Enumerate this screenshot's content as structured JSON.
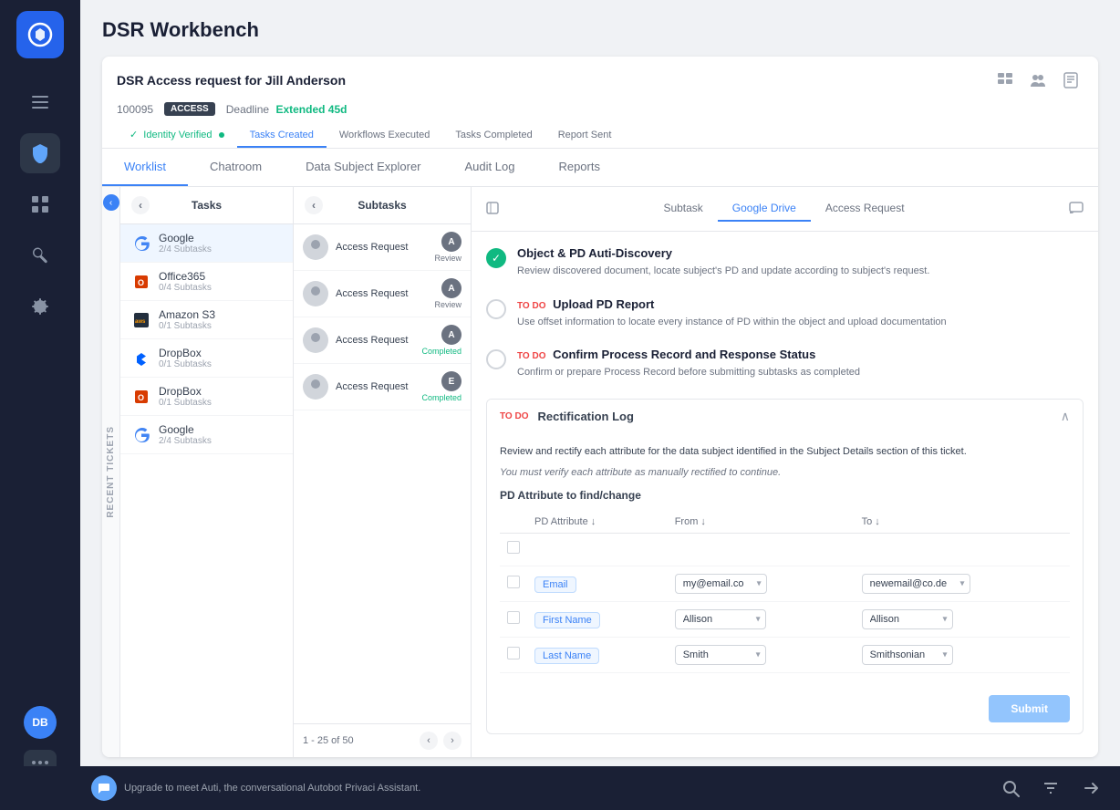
{
  "app": {
    "name": "securiti",
    "page_title": "DSR Workbench"
  },
  "sidebar": {
    "logo_text": "S",
    "menu_icon": "☰",
    "items": [
      {
        "id": "shield",
        "icon": "⬡",
        "active": true
      },
      {
        "id": "grid",
        "icon": "⊞",
        "active": false
      },
      {
        "id": "tools",
        "icon": "⚙",
        "active": false
      },
      {
        "id": "settings",
        "icon": "◎",
        "active": false
      }
    ],
    "avatar_initials": "DB",
    "dots_icon": "⠿"
  },
  "dsr": {
    "title": "DSR Access request for Jill Anderson",
    "ticket_id": "100095",
    "badge": "ACCESS",
    "deadline_label": "Deadline",
    "deadline_value": "Extended 45d"
  },
  "progress_tabs": [
    {
      "id": "identity",
      "label": "Identity Verified",
      "state": "done"
    },
    {
      "id": "tasks",
      "label": "Tasks Created",
      "state": "active"
    },
    {
      "id": "workflows",
      "label": "Workflows Executed",
      "state": "pending"
    },
    {
      "id": "completed",
      "label": "Tasks Completed",
      "state": "pending"
    },
    {
      "id": "report",
      "label": "Report Sent",
      "state": "pending"
    }
  ],
  "main_tabs": [
    {
      "id": "worklist",
      "label": "Worklist",
      "active": true
    },
    {
      "id": "chatroom",
      "label": "Chatroom",
      "active": false
    },
    {
      "id": "data_subject",
      "label": "Data Subject Explorer",
      "active": false
    },
    {
      "id": "audit",
      "label": "Audit Log",
      "active": false
    },
    {
      "id": "reports",
      "label": "Reports",
      "active": false
    }
  ],
  "recent_tickets": {
    "label": "RECENT TICKETS"
  },
  "tasks_panel": {
    "header": "Tasks",
    "items": [
      {
        "id": "google1",
        "logo_type": "google",
        "logo": "G",
        "name": "Google",
        "subtasks": "2/4 Subtasks",
        "active": true
      },
      {
        "id": "office365",
        "logo_type": "office",
        "logo": "O",
        "name": "Office365",
        "subtasks": "0/4 Subtasks"
      },
      {
        "id": "amazons3",
        "logo_type": "aws",
        "logo": "aws",
        "name": "Amazon S3",
        "subtasks": "0/1 Subtasks"
      },
      {
        "id": "dropbox1",
        "logo_type": "dropbox",
        "logo": "✦",
        "name": "DropBox",
        "subtasks": "0/1 Subtasks"
      },
      {
        "id": "dropbox2",
        "logo_type": "office",
        "logo": "O",
        "name": "DropBox",
        "subtasks": "0/1 Subtasks"
      },
      {
        "id": "google2",
        "logo_type": "google",
        "logo": "G",
        "name": "Google",
        "subtasks": "2/4 Subtasks"
      }
    ]
  },
  "subtasks_panel": {
    "header": "Subtasks",
    "items": [
      {
        "id": "sub1",
        "name": "Access Request",
        "badge": "A",
        "badge_class": "a-review",
        "status": "Review",
        "status_class": "review"
      },
      {
        "id": "sub2",
        "name": "Access Request",
        "badge": "A",
        "badge_class": "a-review",
        "status": "Review",
        "status_class": "review"
      },
      {
        "id": "sub3",
        "name": "Access Request",
        "badge": "A",
        "badge_class": "a-review",
        "status": "Completed",
        "status_class": "completed"
      },
      {
        "id": "sub4",
        "name": "Access Request",
        "badge": "E",
        "badge_class": "a-review",
        "status": "Completed",
        "status_class": "completed"
      }
    ],
    "pagination": "1 - 25 of 50"
  },
  "detail": {
    "tabs": [
      {
        "id": "subtask",
        "label": "Subtask",
        "active": false
      },
      {
        "id": "google_drive",
        "label": "Google Drive",
        "active": true
      },
      {
        "id": "access_request",
        "label": "Access Request",
        "active": false
      }
    ],
    "tasks": [
      {
        "id": "task1",
        "done": true,
        "title": "Object & PD Auti-Discovery",
        "description": "Review discovered document, locate subject's PD and update according to subject's request."
      },
      {
        "id": "task2",
        "done": false,
        "todo": true,
        "title": "Upload PD Report",
        "description": "Use offset information to locate every instance of PD within the object and upload documentation"
      },
      {
        "id": "task3",
        "done": false,
        "todo": true,
        "title": "Confirm Process Record and Response Status",
        "description": "Confirm or prepare Process Record before submitting subtasks as completed"
      }
    ],
    "rectification": {
      "todo_label": "TO DO",
      "section_title": "Rectification Log",
      "description": "Review and rectify each attribute for the data subject identified in the Subject Details section of this ticket.",
      "note": "You must verify each attribute as manually rectified to continue.",
      "pd_section_title": "PD Attribute to find/change",
      "table_headers": [
        "PD Attribute ↓",
        "From ↓",
        "To ↓"
      ],
      "rows": [
        {
          "id": "row_email",
          "attribute": "Email",
          "from_value": "my@email.co",
          "to_value": "newemail@co.de"
        },
        {
          "id": "row_firstname",
          "attribute": "First Name",
          "from_value": "Allison",
          "to_value": "Allison"
        },
        {
          "id": "row_lastname",
          "attribute": "Last Name",
          "from_value": "Smith",
          "to_value": "Smithsonian"
        }
      ],
      "submit_label": "Submit"
    }
  },
  "bottom_bar": {
    "upgrade_text": "Upgrade to meet Auti, the conversational Autobot Privaci Assistant.",
    "search_icon": "🔍",
    "filter_icon": "⚙",
    "arrow_icon": "➤"
  }
}
